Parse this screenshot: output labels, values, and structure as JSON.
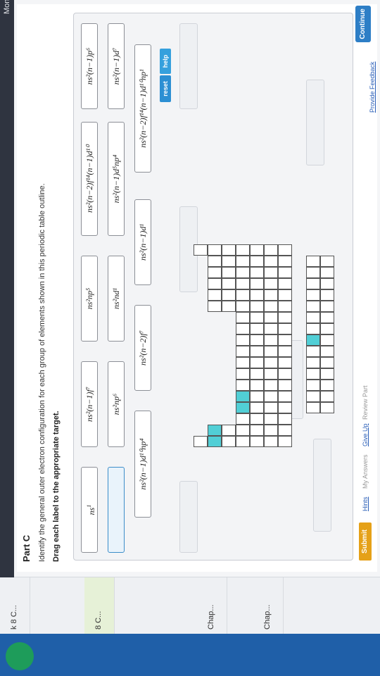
{
  "header": {
    "day": "Monday"
  },
  "sidebar": {
    "items": [
      {
        "label": "Chap..."
      },
      {
        "label": "Chap..."
      },
      {
        "label": "8 C..."
      },
      {
        "label": "k 8 C..."
      }
    ]
  },
  "part": {
    "title": "Part C"
  },
  "instructions": {
    "line1": "Identify the general outer electron configuration for each group of elements shown in this periodic table outline.",
    "line2": "Drag each label to the appropriate target."
  },
  "labels": [
    {
      "text": "ns",
      "sup": "1"
    },
    {
      "text": "ns2(n−1)f7",
      "display": "ns²(n−1)f⁷"
    },
    {
      "text": "ns2np5",
      "display": "ns²np⁵"
    },
    {
      "text": "ns2(n−2)f14(n−1)d10",
      "display": "ns²(n−2)f¹⁴(n−1)d¹⁰"
    },
    {
      "text": "ns2(n−1)p6",
      "display": "ns²(n−1)p⁶"
    },
    {
      "text": "ns2np6",
      "display": "ns²np⁶"
    },
    {
      "text": "ns2nd1",
      "display": "ns²nd¹"
    },
    {
      "text": "ns2(n−1)d5np4",
      "display": "ns²(n−1)d⁵np⁴"
    },
    {
      "text": "ns2(n−1)d7",
      "display": "ns²(n−1)d⁷"
    },
    {
      "text": "ns2(n−1)d10np4",
      "display": "ns²(n−1)d¹⁰np⁴"
    },
    {
      "text": "ns2(n−2)f7",
      "display": "ns²(n−2)f⁷"
    },
    {
      "text": "ns2(n−1)d1",
      "display": "ns²(n−1)d¹"
    },
    {
      "text": "ns2(n−2)f14(n−1)d10np1",
      "display": "ns²(n−2)f¹⁴(n−1)d¹⁰np¹"
    }
  ],
  "controls": {
    "reset": "reset",
    "help": "help"
  },
  "footer": {
    "submit": "Submit",
    "hints": "Hints",
    "my_answers": "My Answers",
    "give_up": "Give Up",
    "review_part": "Review Part"
  },
  "page": {
    "continue": "Continue",
    "feedback": "Provide Feedback"
  },
  "colors": {
    "highlight": "#51cfd6",
    "submit": "#e5a118",
    "continue": "#2d7ec6"
  }
}
